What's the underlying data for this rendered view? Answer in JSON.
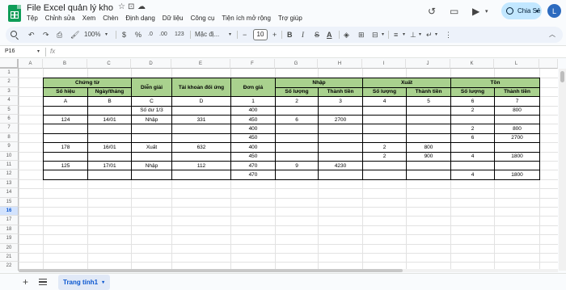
{
  "app": {
    "title": "File Excel quản lý kho",
    "menus": [
      "Tệp",
      "Chỉnh sửa",
      "Xem",
      "Chèn",
      "Định dạng",
      "Dữ liệu",
      "Công cụ",
      "Tiện ích mở rộng",
      "Trợ giúp"
    ],
    "share_label": "Chia Sẻ",
    "avatar_letter": "L"
  },
  "toolbar": {
    "zoom": "100%",
    "currency": "$",
    "percent": "%",
    "decrease_decimal": ".0",
    "increase_decimal": ".00",
    "number_format": "123",
    "font": "Mặc đị...",
    "font_size": "10",
    "bold": "B",
    "italic": "I",
    "strike": "S",
    "text_color": "A"
  },
  "formula_bar": {
    "cell_ref": "P16",
    "fx": "fx",
    "content": ""
  },
  "grid": {
    "columns": [
      "A",
      "B",
      "C",
      "D",
      "E",
      "F",
      "G",
      "H",
      "I",
      "J",
      "K",
      "L"
    ],
    "rows": [
      "1",
      "2",
      "3",
      "4",
      "5",
      "6",
      "7",
      "8",
      "9",
      "10",
      "11",
      "12",
      "13",
      "14",
      "15",
      "16",
      "17",
      "18",
      "19",
      "20",
      "21",
      "22"
    ],
    "selected_row": "16"
  },
  "table": {
    "group_headers": {
      "chung_tu": "Chứng từ",
      "dien_giai": "Diễn giải",
      "tai_khoan": "Tài khoản đối ứng",
      "don_gia": "Đơn giá",
      "nhap": "Nhập",
      "xuat": "Xuất",
      "ton": "Tồn"
    },
    "sub_headers": [
      "Số hiệu",
      "Ngày/tháng",
      "Số lượng",
      "Thành tiền",
      "Số lượng",
      "Thành tiền",
      "Số lượng",
      "Thành tiền"
    ],
    "rows": [
      [
        "A",
        "B",
        "C",
        "D",
        "1",
        "2",
        "3",
        "4",
        "5",
        "6",
        "7"
      ],
      [
        "",
        "",
        "Số dư 1/3",
        "",
        "400",
        "",
        "",
        "",
        "",
        "2",
        "800"
      ],
      [
        "124",
        "14/01",
        "Nhập",
        "331",
        "450",
        "6",
        "2700",
        "",
        "",
        "",
        ""
      ],
      [
        "",
        "",
        "",
        "",
        "400",
        "",
        "",
        "",
        "",
        "2",
        "800"
      ],
      [
        "",
        "",
        "",
        "",
        "450",
        "",
        "",
        "",
        "",
        "6",
        "2700"
      ],
      [
        "178",
        "16/01",
        "Xuất",
        "632",
        "400",
        "",
        "",
        "2",
        "800",
        "",
        ""
      ],
      [
        "",
        "",
        "",
        "",
        "450",
        "",
        "",
        "2",
        "900",
        "4",
        "1800"
      ],
      [
        "125",
        "17/01",
        "Nhập",
        "112",
        "470",
        "9",
        "4230",
        "",
        "",
        "",
        ""
      ],
      [
        "",
        "",
        "",
        "",
        "470",
        "",
        "",
        "",
        "",
        "4",
        "1800"
      ]
    ]
  },
  "sheets": {
    "active": "Trang tính1"
  },
  "colors": {
    "header_fill": "#a9d18e",
    "share_button": "#c2e7ff",
    "sheets_green": "#0f9d58"
  }
}
